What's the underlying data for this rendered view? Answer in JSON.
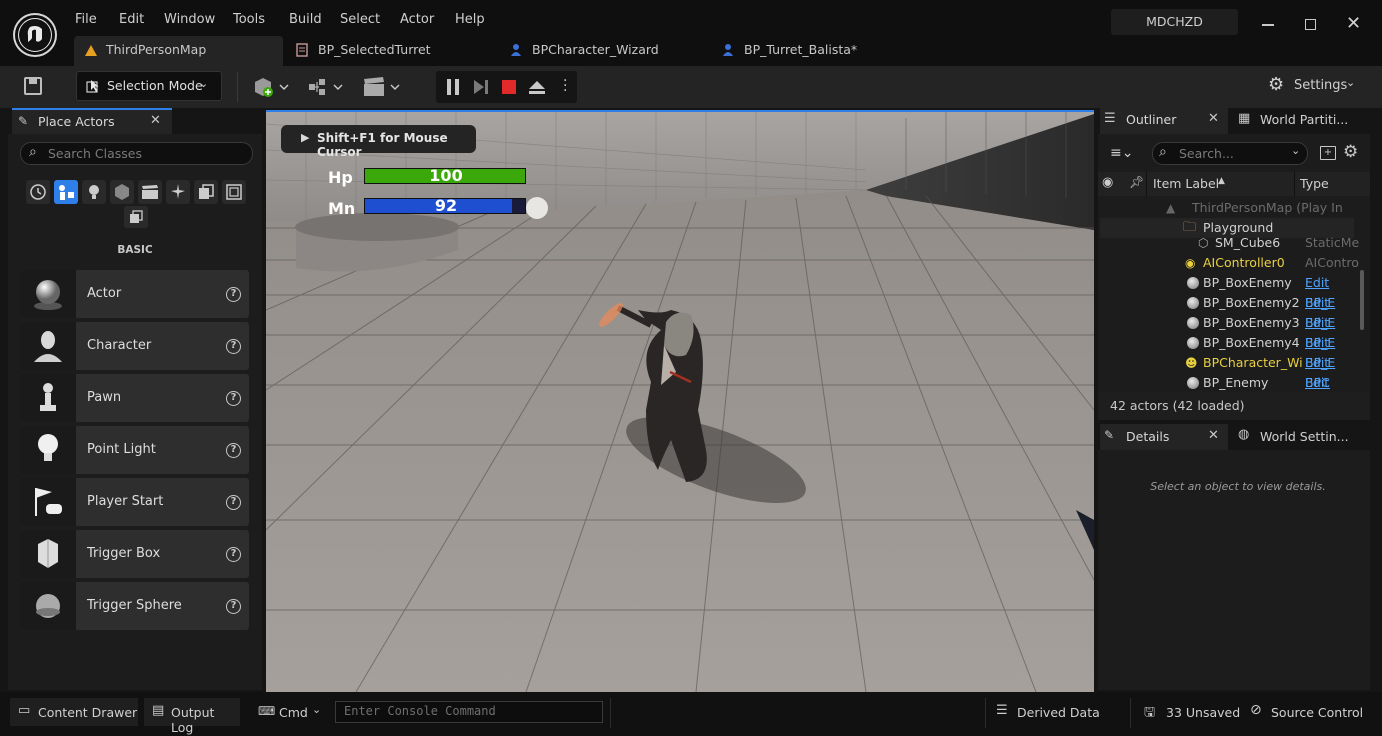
{
  "menu": [
    "File",
    "Edit",
    "Window",
    "Tools",
    "Build",
    "Select",
    "Actor",
    "Help"
  ],
  "project_name": "MDCHZD",
  "tabs": [
    {
      "label": "ThirdPersonMap",
      "icon": "level-icon",
      "active": true
    },
    {
      "label": "BP_SelectedTurret",
      "icon": "blueprint-icon",
      "active": false
    },
    {
      "label": "BPCharacter_Wizard",
      "icon": "character-blueprint-icon",
      "active": false
    },
    {
      "label": "BP_Turret_Balista*",
      "icon": "character-blueprint-icon",
      "active": false
    }
  ],
  "toolbar": {
    "mode_label": "Selection Mode",
    "settings_label": "Settings"
  },
  "place_actors": {
    "title": "Place Actors",
    "search_placeholder": "Search Classes",
    "category_label": "BASIC",
    "items": [
      "Actor",
      "Character",
      "Pawn",
      "Point Light",
      "Player Start",
      "Trigger Box",
      "Trigger Sphere"
    ]
  },
  "viewport": {
    "hint": "Shift+F1 for Mouse Cursor",
    "hp_label": "Hp",
    "hp_value": "100",
    "hp_fraction": 1.0,
    "mn_label": "Mn",
    "mn_value": "92",
    "mn_fraction": 0.92
  },
  "outliner": {
    "title": "Outliner",
    "tab2": "World Partiti...",
    "search_placeholder": "Search...",
    "col_label": "Item Label",
    "col_type": "Type",
    "rows": [
      {
        "name": "ThirdPersonMap (Play In Edi",
        "type": "",
        "kind": "map"
      },
      {
        "name": "Playground",
        "type": "",
        "kind": "folder"
      },
      {
        "name": "SM_Cube6",
        "type": "StaticMe",
        "kind": "mesh"
      },
      {
        "name": "AIController0",
        "type": "AIContro",
        "kind": "controller"
      },
      {
        "name": "BP_BoxEnemy",
        "type": "Edit BP_E",
        "kind": "actor"
      },
      {
        "name": "BP_BoxEnemy2",
        "type": "Edit BP_E",
        "kind": "actor"
      },
      {
        "name": "BP_BoxEnemy3",
        "type": "Edit BP_E",
        "kind": "actor"
      },
      {
        "name": "BP_BoxEnemy4",
        "type": "Edit BP_E",
        "kind": "actor"
      },
      {
        "name": "BPCharacter_Wi",
        "type": "Edit BPC",
        "kind": "player"
      },
      {
        "name": "BP_Enemy",
        "type": "Edit BP_E",
        "kind": "actor"
      }
    ],
    "count": "42 actors (42 loaded)"
  },
  "details": {
    "title": "Details",
    "tab2": "World Settin...",
    "empty": "Select an object to view details."
  },
  "status": {
    "content_drawer": "Content Drawer",
    "output_log": "Output Log",
    "cmd": "Cmd",
    "console_placeholder": "Enter Console Command",
    "derived_data": "Derived Data",
    "unsaved": "33 Unsaved",
    "source_control": "Source Control"
  },
  "colors": {
    "accent": "#2f7fe8",
    "hp": "#3aa80a",
    "mn": "#1e4fd0",
    "selected_tab": "#242424"
  }
}
